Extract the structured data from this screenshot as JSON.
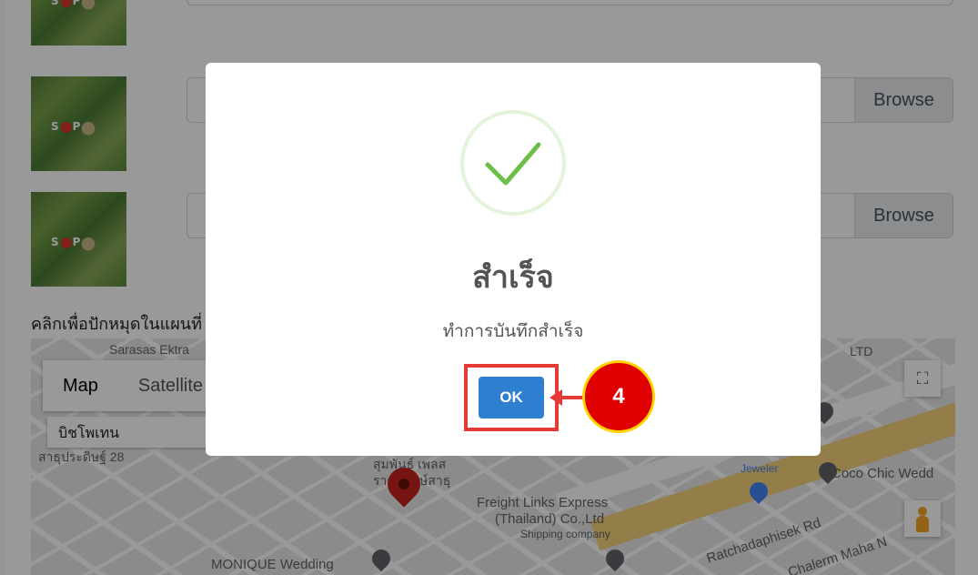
{
  "form": {
    "browse_label_1": "Browse",
    "browse_label_2": "Browse",
    "thumb_logo": "STOP"
  },
  "map_section": {
    "instruction": "คลิกเพื่อปักหมุดในแผนที่",
    "map_type": {
      "map": "Map",
      "satellite": "Satellite"
    },
    "search_value": "บิชโพเทน",
    "labels": {
      "top_left": "Sarasas Ektra",
      "street_left": "สาธุประดิษฐ์ 28",
      "place_center": "สุมพันธ์ เพลส",
      "place_center_2": "ราชพฤกษ์สาธุ",
      "freight_1": "Freight Links Express",
      "freight_2": "(Thailand) Co.,Ltd",
      "freight_3": "Shipping company",
      "monique": "MONIQUE Wedding",
      "jeweler": "Jeweler",
      "coco": "Coco Chic Wedd",
      "ratchada": "Ratchadaphisek Rd",
      "chalerm": "Chalerm Maha N",
      "ltd": "LTD"
    }
  },
  "dialog": {
    "title": "สำเร็จ",
    "message": "ทำการบันทึกสำเร็จ",
    "ok_label": "OK",
    "icon": "success-check-icon",
    "check_color": "#6cc04a"
  },
  "annotation": {
    "step_number": "4",
    "color": "#e53935"
  }
}
